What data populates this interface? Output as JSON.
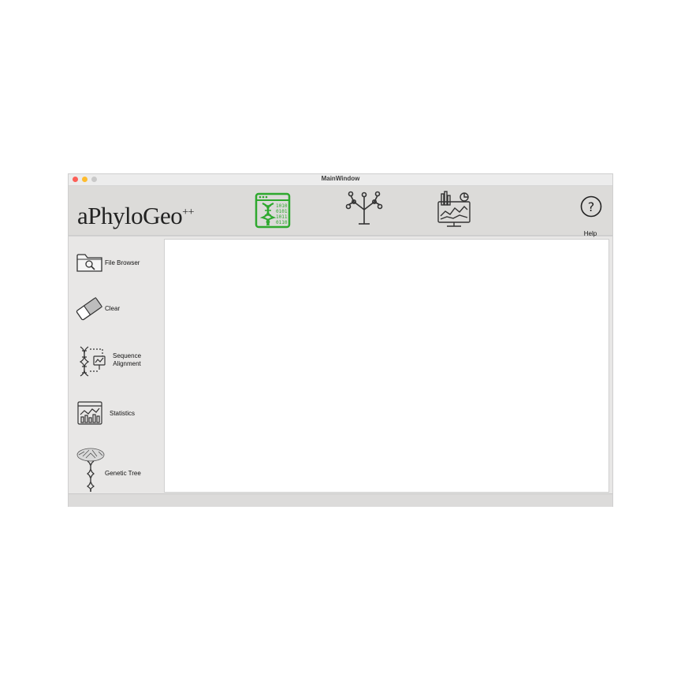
{
  "window": {
    "title": "MainWindow"
  },
  "toolbar": {
    "logo": "aPhyloGeo",
    "logo_superscript": "++",
    "buttons": [
      {
        "icon": "dna-sequence-icon",
        "active": true,
        "accent": "#2ea82e"
      },
      {
        "icon": "phylogenetic-tree-icon",
        "active": false
      },
      {
        "icon": "statistics-dashboard-icon",
        "active": false
      }
    ],
    "help_label": "Help"
  },
  "sidebar": {
    "items": [
      {
        "label": "File Browser",
        "icon": "folder-search-icon"
      },
      {
        "label": "Clear",
        "icon": "eraser-icon"
      },
      {
        "label": "Sequence Alignment",
        "icon": "sequence-alignment-icon"
      },
      {
        "label": "Statistics",
        "icon": "statistics-icon"
      },
      {
        "label": "Genetic Tree",
        "icon": "genetic-tree-icon"
      }
    ]
  }
}
